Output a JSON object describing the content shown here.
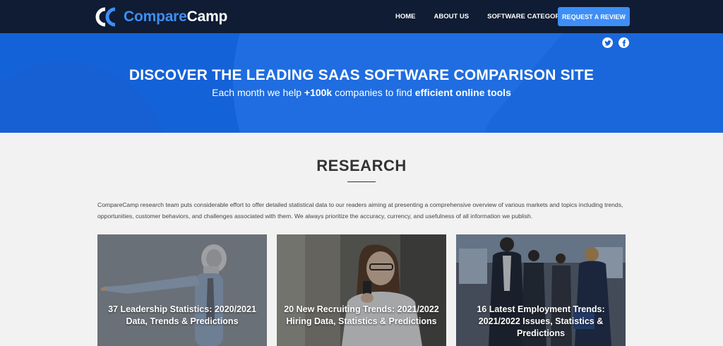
{
  "brand": {
    "name_part1": "Compare",
    "name_part2": "Camp",
    "logo_icon": "comparecamp-logo-icon",
    "accent_color": "#3e8ef7",
    "nav_bg": "#0f1c33"
  },
  "nav": {
    "links": [
      {
        "label": "HOME"
      },
      {
        "label": "ABOUT US"
      },
      {
        "label": "SOFTWARE CATEGORIES"
      }
    ],
    "cta_label": "REQUEST A REVIEW"
  },
  "hero": {
    "bg_color": "#1462d8",
    "title": "DISCOVER THE LEADING SAAS SOFTWARE COMPARISON SITE",
    "subtitle_pre": "Each month we help ",
    "subtitle_bold1": "+100k",
    "subtitle_mid": " companies to find ",
    "subtitle_bold2": "efficient online tools",
    "social": [
      {
        "icon": "twitter-icon"
      },
      {
        "icon": "facebook-icon"
      }
    ]
  },
  "research": {
    "title": "RESEARCH",
    "intro": "CompareCamp research team puts considerable effort to offer detailed statistical data to our readers aiming at presenting a comprehensive overview of various markets and topics including trends, opportunities, customer behaviors, and challenges associated with them. We always prioritize the accuracy, currency, and usefulness of all information we publish.",
    "cards": [
      {
        "title": "37 Leadership Statistics: 2020/2021 Data, Trends & Predictions"
      },
      {
        "title": "20 New Recruiting Trends: 2021/2022 Hiring Data, Statistics & Predictions"
      },
      {
        "title": "16 Latest Employment Trends: 2021/2022 Issues, Statistics & Predictions"
      }
    ]
  }
}
